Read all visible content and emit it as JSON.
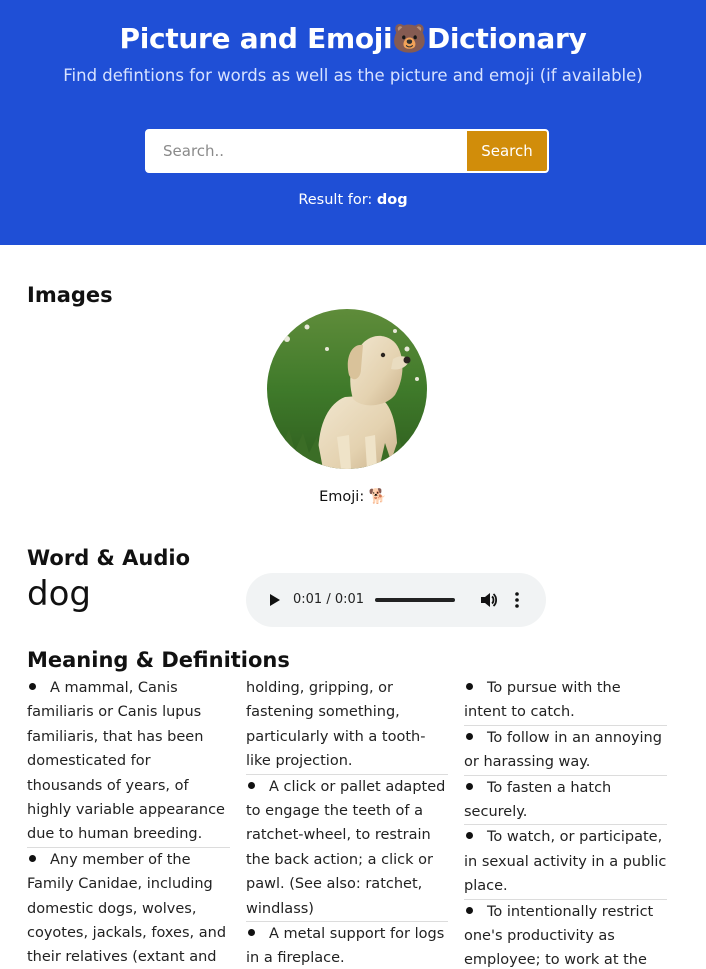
{
  "header": {
    "title": "Picture and Emoji",
    "title_emoji": "🐻",
    "title_suffix": "Dictionary",
    "subtitle": "Find defintions for words as well as the picture and emoji (if available)"
  },
  "search": {
    "placeholder": "Search..",
    "value": "",
    "button_label": "Search"
  },
  "result": {
    "prefix": "Result for: ",
    "word": "dog"
  },
  "images": {
    "heading": "Images",
    "emoji_label": "Emoji: ",
    "emoji": "🐕"
  },
  "word_audio": {
    "heading": "Word & Audio",
    "word": "dog",
    "time": "0:01 / 0:01",
    "progress": 1.0
  },
  "definitions": {
    "heading": "Meaning & Definitions",
    "columns": [
      [
        {
          "bullet": true,
          "text": "A mammal, Canis familiaris or Canis lupus familiaris, that has been domesticated for thousands of years, of highly variable appearance due to human breeding."
        },
        {
          "bullet": true,
          "text": "Any member of the Family Canidae, including domestic dogs, wolves, coyotes, jackals, foxes, and their relatives (extant and"
        }
      ],
      [
        {
          "bullet": false,
          "text": "holding, gripping, or fastening something, particularly with a tooth-like projection."
        },
        {
          "bullet": true,
          "text": "A click or pallet adapted to engage the teeth of a ratchet-wheel, to restrain the back action; a click or pawl. (See also: ratchet, windlass)"
        },
        {
          "bullet": true,
          "text": "A metal support for logs in a fireplace."
        }
      ],
      [
        {
          "bullet": true,
          "text": "To pursue with the intent to catch."
        },
        {
          "bullet": true,
          "text": "To follow in an annoying or harassing way."
        },
        {
          "bullet": true,
          "text": "To fasten a hatch securely."
        },
        {
          "bullet": true,
          "text": "To watch, or participate, in sexual activity in a public place."
        },
        {
          "bullet": true,
          "text": "To intentionally restrict one's productivity as employee; to work at the"
        }
      ]
    ]
  },
  "colors": {
    "header_bg": "#1f4fd6",
    "search_button": "#d18d0a"
  }
}
